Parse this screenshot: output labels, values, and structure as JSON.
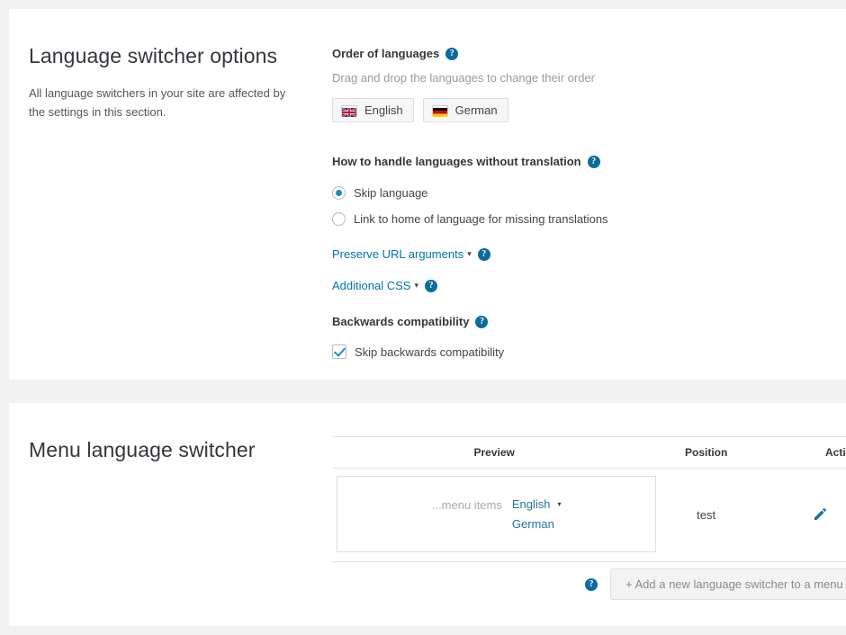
{
  "options_panel": {
    "title": "Language switcher options",
    "description": "All language switchers in your site are affected by the settings in this section.",
    "order_field": {
      "label": "Order of languages",
      "help": "?",
      "hint": "Drag and drop the languages to change their order",
      "languages": [
        {
          "name": "English",
          "flag": "uk-flag-icon"
        },
        {
          "name": "German",
          "flag": "german-flag-icon"
        }
      ]
    },
    "missing_translation_field": {
      "label": "How to handle languages without translation",
      "help": "?",
      "options": [
        {
          "label": "Skip language",
          "selected": true
        },
        {
          "label": "Link to home of language for missing translations",
          "selected": false
        }
      ]
    },
    "toggles": [
      {
        "label": "Preserve URL arguments",
        "caret": "▾",
        "help": "?"
      },
      {
        "label": "Additional CSS",
        "caret": "▾",
        "help": "?"
      }
    ],
    "backwards_field": {
      "label": "Backwards compatibility",
      "help": "?",
      "checkbox_label": "Skip backwards compatibility",
      "checked": true
    }
  },
  "menu_panel": {
    "title": "Menu language switcher",
    "table": {
      "headers": {
        "preview": "Preview",
        "position": "Position",
        "actions": "Actions"
      },
      "rows": [
        {
          "preview": {
            "menu_items": "...menu items",
            "languages": [
              "English",
              "German"
            ],
            "caret": "▾"
          },
          "position": "test",
          "actions": {
            "edit": "edit-pencil-icon",
            "delete": "delete-trash-icon"
          }
        }
      ]
    },
    "add_button": {
      "help": "?",
      "label": "+ Add a new language switcher to a menu"
    }
  },
  "colors": {
    "link": "#0073aa",
    "accent": "#1e8cbe",
    "help_bubble": "#0b6ca0",
    "edit_icon": "#1b72a8",
    "delete_icon": "#cc2b2b",
    "panel_bg": "#ffffff",
    "page_bg": "#f1f1f1"
  }
}
